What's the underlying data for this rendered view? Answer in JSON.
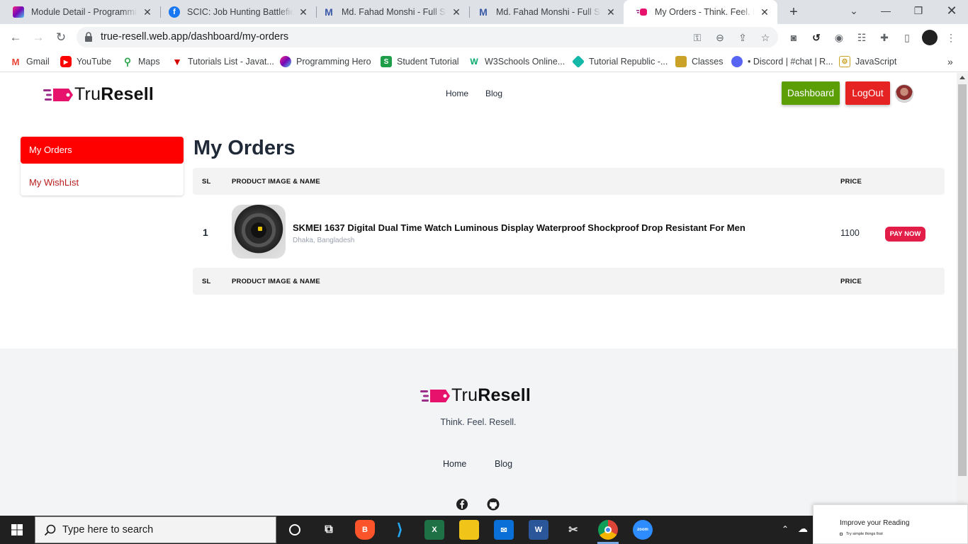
{
  "browser": {
    "tabs": [
      {
        "title": "Module Detail - Programmin",
        "icon": "programming-hero-icon",
        "color": "#9b5de5"
      },
      {
        "title": "SCIC: Job Hunting Battlefield",
        "icon": "facebook-icon",
        "color": "#1877f2"
      },
      {
        "title": "Md. Fahad Monshi - Full Stac",
        "icon": "m-logo-icon",
        "color": "#3b5aa8"
      },
      {
        "title": "Md. Fahad Monshi - Full Stac",
        "icon": "m-logo-icon",
        "color": "#3b5aa8"
      },
      {
        "title": "My Orders - Think. Feel. Rese",
        "icon": "truresell-icon",
        "color": "#e6126b"
      }
    ],
    "url": "true-resell.web.app/dashboard/my-orders",
    "bookmarks": [
      {
        "label": "Gmail",
        "icon": "gmail-icon",
        "color": "#ea4335"
      },
      {
        "label": "YouTube",
        "icon": "youtube-icon",
        "color": "#ff0000"
      },
      {
        "label": "Maps",
        "icon": "maps-icon",
        "color": "#34a853"
      },
      {
        "label": "Tutorials List - Javat...",
        "icon": "javatpoint-icon",
        "color": "#d50000"
      },
      {
        "label": "Programming Hero",
        "icon": "programming-hero-icon",
        "color": "#9b5de5"
      },
      {
        "label": "Student Tutorial",
        "icon": "student-tutorial-icon",
        "color": "#1e9e49"
      },
      {
        "label": "W3Schools Online...",
        "icon": "w3schools-icon",
        "color": "#04aa6d"
      },
      {
        "label": "Tutorial Republic -...",
        "icon": "tutorial-republic-icon",
        "color": "#14b8a6"
      },
      {
        "label": "Classes",
        "icon": "classes-icon",
        "color": "#c9a227"
      },
      {
        "label": "• Discord | #chat | R...",
        "icon": "discord-icon",
        "color": "#5865f2"
      },
      {
        "label": "JavaScript",
        "icon": "javascript-icon",
        "color": "#c9a227"
      }
    ]
  },
  "site": {
    "brand_light": "Tru",
    "brand_bold": "Resell",
    "nav": {
      "home": "Home",
      "blog": "Blog"
    },
    "dashboard_label": "Dashboard",
    "logout_label": "LogOut",
    "sidebar": {
      "active": "My Orders",
      "wishlist": "My WishList"
    },
    "heading": "My Orders",
    "table": {
      "headers": {
        "sl": "SL",
        "product": "PRODUCT IMAGE & NAME",
        "price": "PRICE"
      },
      "rows": [
        {
          "sl": "1",
          "name": "SKMEI 1637 Digital Dual Time Watch Luminous Display Waterproof Shockproof Drop Resistant For Men",
          "location": "Dhaka, Bangladesh",
          "price": "1100",
          "action": "PAY NOW"
        }
      ]
    },
    "footer": {
      "tagline": "Think. Feel. Resell.",
      "nav": {
        "home": "Home",
        "blog": "Blog"
      }
    },
    "colors": {
      "dashboard": "#5b9e06",
      "logout": "#e62323",
      "active": "#ff0000",
      "pay": "#e11d48"
    }
  },
  "taskbar": {
    "search_placeholder": "Type here to search",
    "notification": {
      "title": "Improve your Reading",
      "sub": "Try simple things first"
    }
  }
}
